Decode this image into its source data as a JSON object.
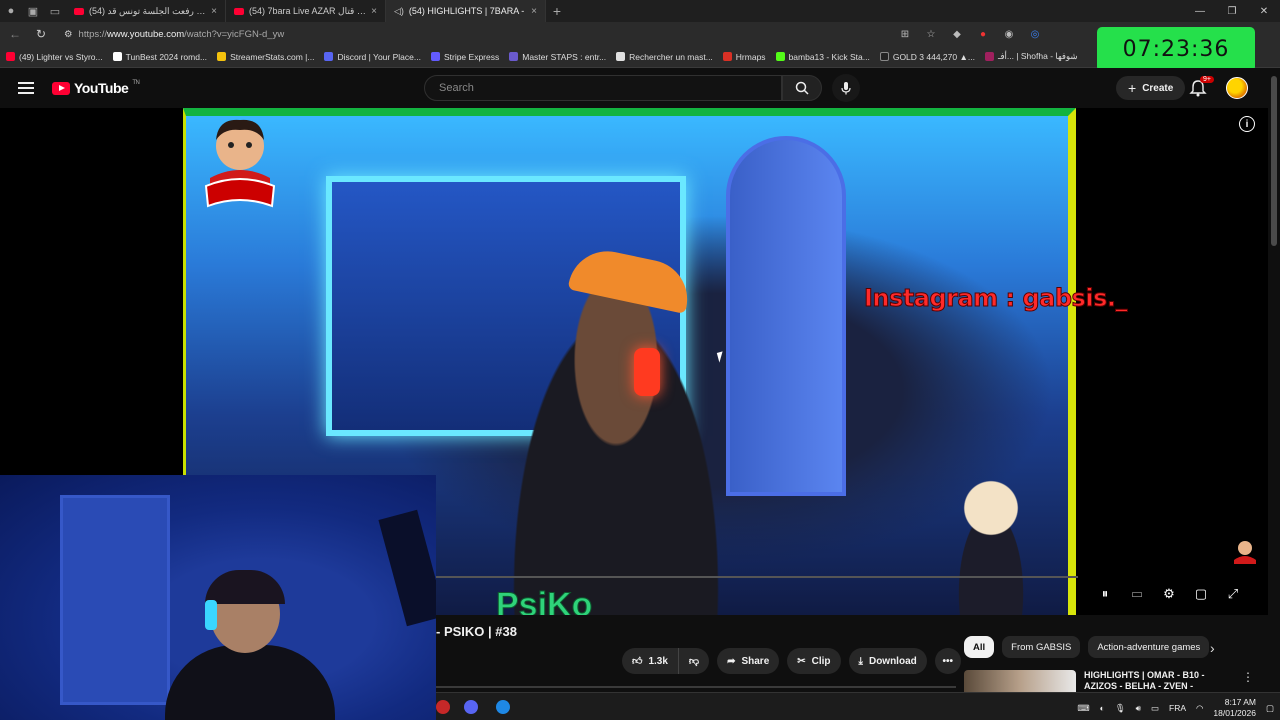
{
  "browser": {
    "tabs": [
      {
        "label": "(54) برنامج رفعت الجلسة تونس قد..."
      },
      {
        "label": "(54) 7bara Live AZAR لقطات قتال..."
      },
      {
        "label": "(54) HIGHLIGHTS | 7BARA -"
      }
    ],
    "new_tab": "+",
    "url_prefix": "https://",
    "url_host": "www.youtube.com",
    "url_path": "/watch?v=yicFGN-d_yw",
    "bookmarks": [
      {
        "label": "(49) Lighter vs Styro...",
        "color": "#ff0033"
      },
      {
        "label": "TunBest 2024 romd...",
        "color": "#ffffff"
      },
      {
        "label": "StreamerStats.com |...",
        "color": "#f4c20d"
      },
      {
        "label": "Discord | Your Place...",
        "color": "#5865f2"
      },
      {
        "label": "Stripe Express",
        "color": "#635bff"
      },
      {
        "label": "Master STAPS : entr...",
        "color": "#6a5acd"
      },
      {
        "label": "Rechercher un mast...",
        "color": "#e0e0e0"
      },
      {
        "label": "Hrmaps",
        "color": "#d93025"
      },
      {
        "label": "bamba13 - Kick Sta...",
        "color": "#53fc18"
      },
      {
        "label": "GOLD 3 444,270 ▲...",
        "color": "#222222"
      },
      {
        "label": "أفـ... | Shofha - شوفها",
        "color": "#a0205e"
      }
    ]
  },
  "overlay_clock": "07:23:36",
  "youtube": {
    "logo_text": "YouTube",
    "logo_sup": "TN",
    "search_placeholder": "Search",
    "create_label": "Create",
    "notif_badge": "9+",
    "video": {
      "instagram_text": "Instagram : gabsis._",
      "title_partial": "- PSIKO | #38"
    },
    "actions": {
      "likes": "1.3k",
      "share": "Share",
      "clip": "Clip",
      "download": "Download"
    },
    "chips": [
      "All",
      "From GABSIS",
      "Action-adventure games"
    ],
    "recommendation": {
      "title": "HIGHLIGHTS | OMAR - B10 - AZIZOS - BELHA - ZVEN -"
    }
  },
  "taskbar": {
    "lang": "FRA",
    "time": "8:17 AM",
    "date": "18/01/2026"
  }
}
